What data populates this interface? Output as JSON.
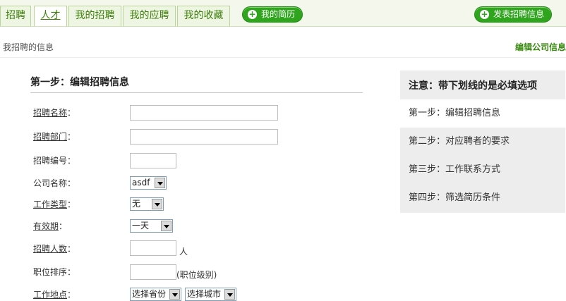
{
  "nav": {
    "tabs": [
      {
        "label": "招聘"
      },
      {
        "label": "人才"
      },
      {
        "label": "我的招聘"
      },
      {
        "label": "我的应聘"
      },
      {
        "label": "我的收藏"
      }
    ],
    "my_resume_label": "我的简历",
    "post_job_label": "发表招聘信息",
    "accent": "#2ea51d"
  },
  "subbar": {
    "breadcrumb": "我招聘的信息",
    "edit_company_label": "编辑公司信息"
  },
  "form": {
    "step_title": "第一步：编辑招聘信息",
    "fields": {
      "job_name": {
        "label": "招聘名称",
        "colon": "：",
        "value": ""
      },
      "department": {
        "label": "招聘部门",
        "colon": "：",
        "value": ""
      },
      "job_number": {
        "label": "招聘编号：",
        "value": ""
      },
      "company": {
        "label": "公司名称：",
        "selected": "asdf"
      },
      "work_type": {
        "label": "工作类型",
        "colon": "：",
        "selected": "无"
      },
      "validity": {
        "label": "有效期",
        "colon": "：",
        "selected": "一天"
      },
      "headcount": {
        "label": "招聘人数",
        "colon": "：",
        "value": "",
        "suffix": "人"
      },
      "position_rank": {
        "label": "职位排序：",
        "value": "",
        "suffix": "(职位级别)"
      },
      "location": {
        "label": "工作地点",
        "colon": "：",
        "province": "选择省份",
        "city": "选择城市"
      }
    }
  },
  "panel": {
    "title": "注意：带下划线的是必填选项",
    "steps": [
      {
        "label": "第一步：编辑招聘信息"
      },
      {
        "label": "第二步：对应聘者的要求"
      },
      {
        "label": "第三步：工作联系方式"
      },
      {
        "label": "第四步：筛选简历条件"
      }
    ]
  }
}
